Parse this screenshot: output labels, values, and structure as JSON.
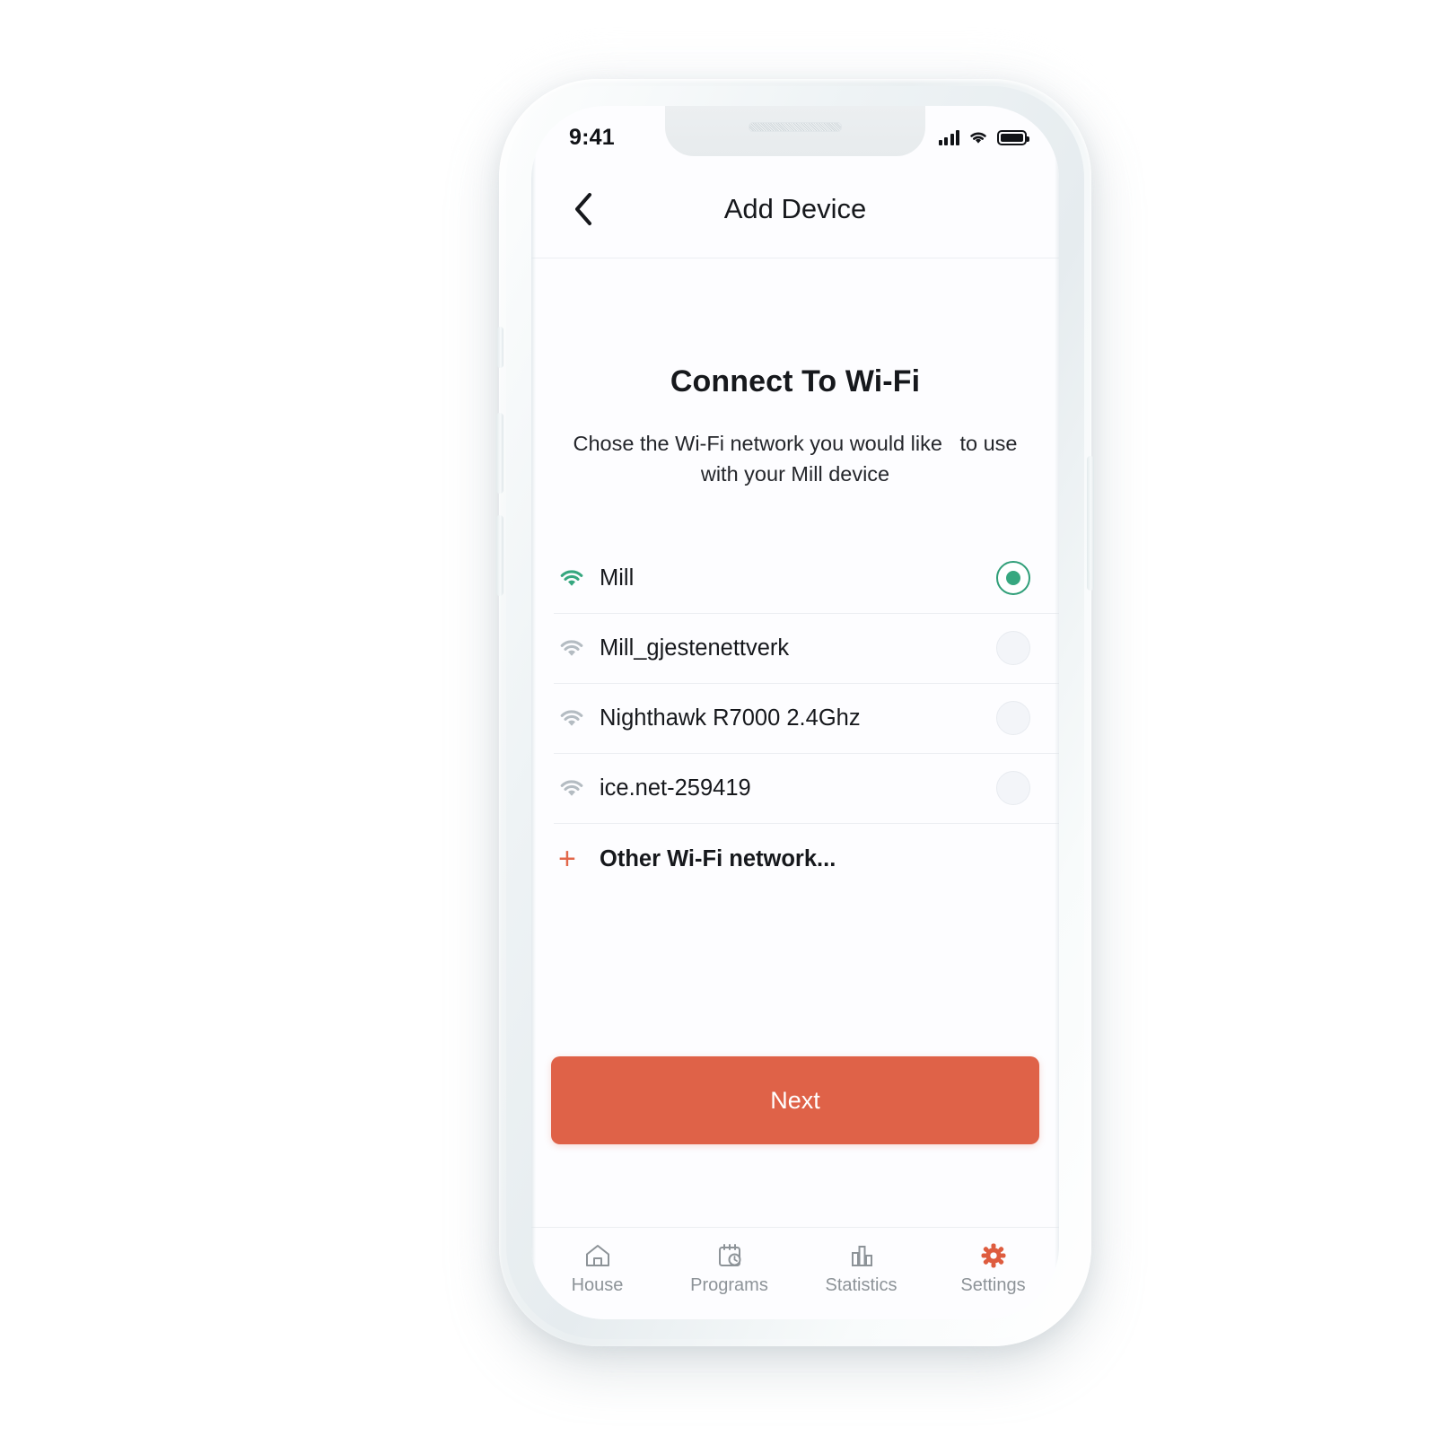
{
  "status_bar": {
    "time": "9:41",
    "signal_icon": "signal-bars-icon",
    "wifi_icon": "wifi-icon",
    "battery_icon": "battery-full-icon"
  },
  "header": {
    "back_icon": "chevron-left-icon",
    "title": "Add Device"
  },
  "main": {
    "title": "Connect To Wi-Fi",
    "subtitle": "Chose the Wi-Fi network you would like   to use with your Mill device",
    "networks": [
      {
        "name": "Mill",
        "selected": true,
        "icon": "wifi-icon"
      },
      {
        "name": "Mill_gjestenettverk",
        "selected": false,
        "icon": "wifi-icon"
      },
      {
        "name": "Nighthawk R7000 2.4Ghz",
        "selected": false,
        "icon": "wifi-icon"
      },
      {
        "name": "ice.net-259419",
        "selected": false,
        "icon": "wifi-icon"
      }
    ],
    "other_network": {
      "label": "Other Wi-Fi network...",
      "icon": "plus-icon"
    },
    "primary_action": "Next"
  },
  "tab_bar": {
    "items": [
      {
        "label": "House",
        "icon": "home-icon",
        "active": false
      },
      {
        "label": "Programs",
        "icon": "calendar-clock-icon",
        "active": false
      },
      {
        "label": "Statistics",
        "icon": "bar-chart-icon",
        "active": false
      },
      {
        "label": "Settings",
        "icon": "gear-icon",
        "active": true
      }
    ]
  },
  "colors": {
    "accent_orange": "#df6248",
    "accent_green": "#36a77f",
    "text_primary": "#16181c",
    "text_muted": "#8d9398",
    "divider": "#eceef2",
    "screen_bg": "#fdfdff"
  }
}
